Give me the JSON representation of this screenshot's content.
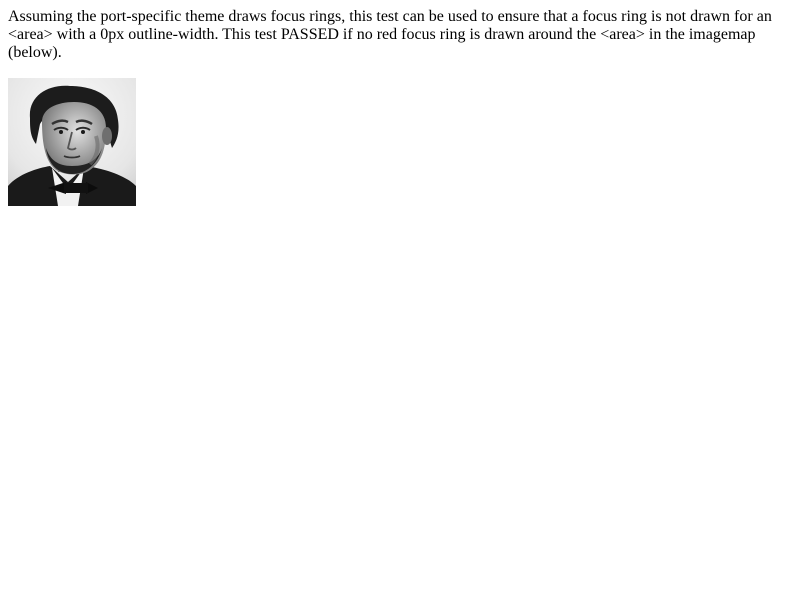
{
  "description": "Assuming the port-specific theme draws focus rings, this test can be used to ensure that a focus ring is not drawn for an <area> with a 0px outline-width. This test PASSED if no red focus ring is drawn around the <area> in the imagemap (below).",
  "image": {
    "icon": "portrait-photo-icon",
    "style": "grayscale portrait photograph"
  },
  "colors": {
    "background": "#ffffff",
    "text": "#000000"
  }
}
